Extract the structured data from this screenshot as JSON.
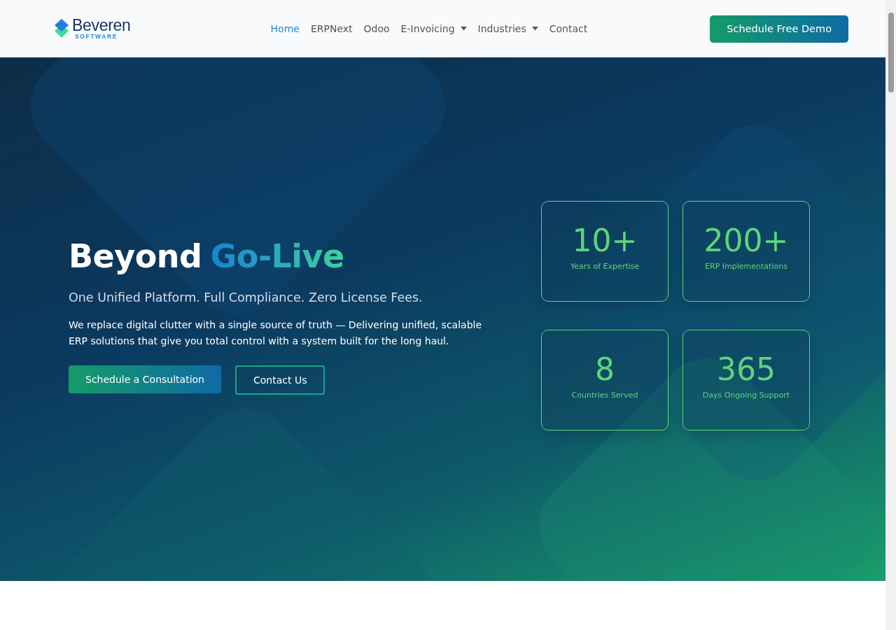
{
  "header": {
    "logo": {
      "name": "Beveren",
      "tagline": "SOFTWARE"
    },
    "nav": [
      {
        "label": "Home",
        "selected": true,
        "dropdown": false
      },
      {
        "label": "ERPNext",
        "selected": false,
        "dropdown": false
      },
      {
        "label": "Odoo",
        "selected": false,
        "dropdown": false
      },
      {
        "label": "E-Invoicing",
        "selected": false,
        "dropdown": true
      },
      {
        "label": "Industries",
        "selected": false,
        "dropdown": true
      },
      {
        "label": "Contact",
        "selected": false,
        "dropdown": false
      }
    ],
    "cta": "Schedule Free Demo"
  },
  "hero": {
    "title_lead": "Beyond",
    "title_accent": "Go-Live",
    "subtitle": "One Unified Platform. Full Compliance. Zero License Fees.",
    "description": "We replace digital clutter with a single source of truth — Delivering unified, scalable ERP solutions that give you total control with a system built for the long haul.",
    "buttons": [
      {
        "label": "Schedule a Consultation",
        "kind": "primary"
      },
      {
        "label": "Contact Us",
        "kind": "outline"
      }
    ],
    "stats": [
      {
        "value": "10+",
        "label": "Years of Expertise"
      },
      {
        "value": "200+",
        "label": "ERP Implementations"
      },
      {
        "value": "8",
        "label": "Countries Served"
      },
      {
        "value": "365",
        "label": "Days Ongoing Support"
      }
    ]
  }
}
